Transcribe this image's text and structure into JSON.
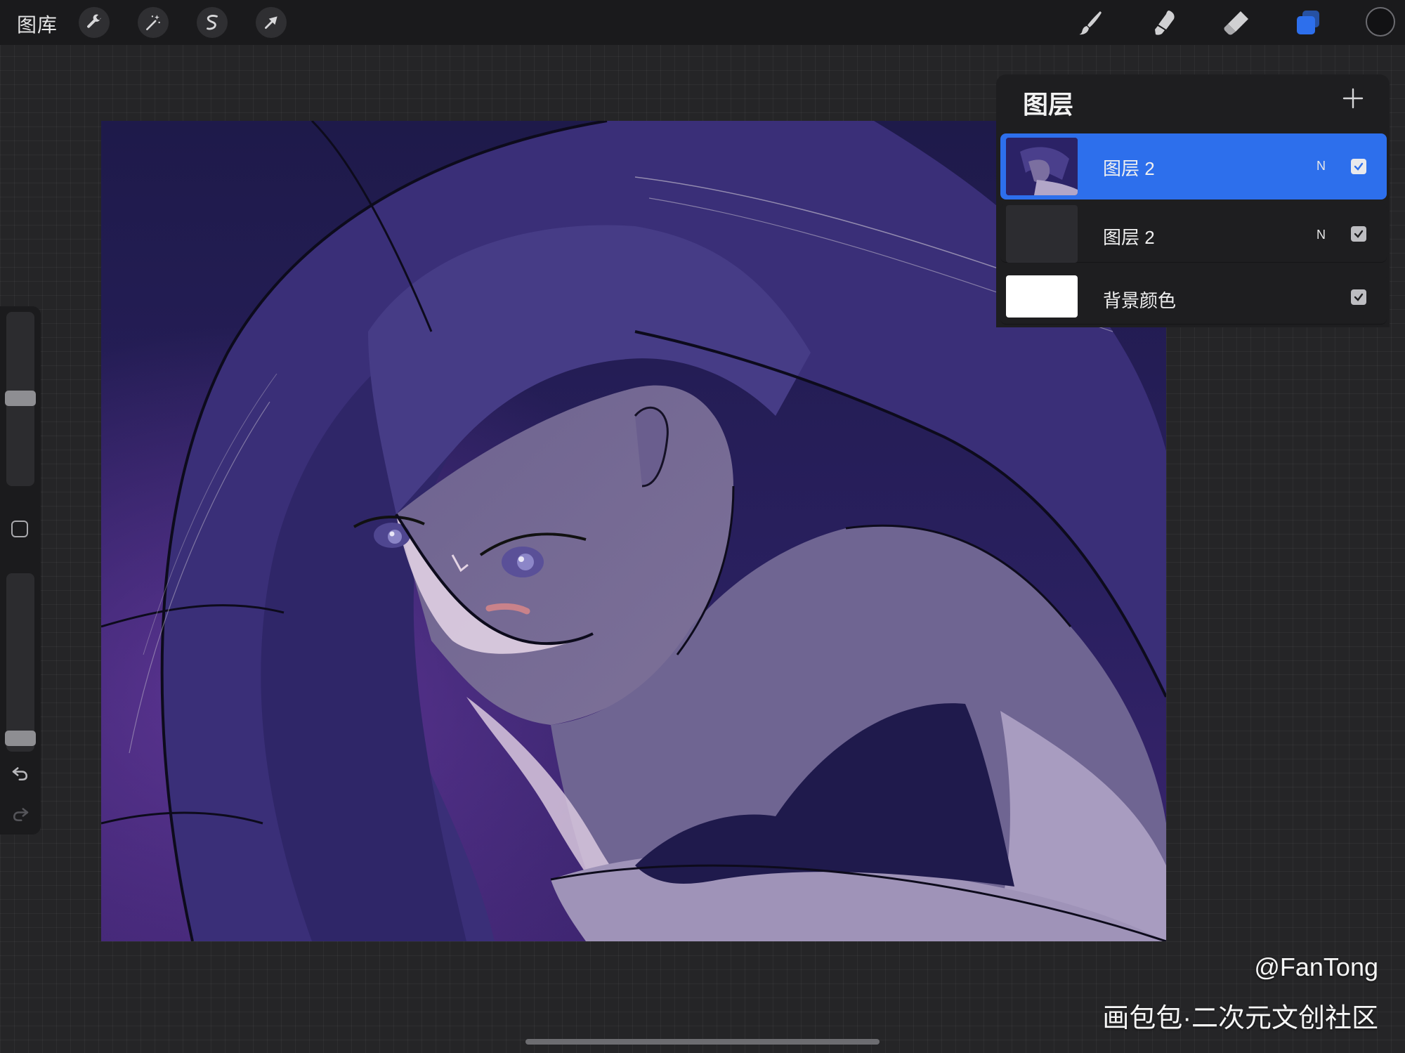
{
  "toolbar": {
    "gallery_label": "图库",
    "left_tools": [
      "wrench-icon",
      "magic-wand-icon",
      "selection-icon",
      "transform-arrow-icon"
    ],
    "right_tools": [
      "brush-icon",
      "smudge-icon",
      "eraser-icon",
      "layers-icon"
    ],
    "active_color": "#121214",
    "accent_color": "#2d6fec"
  },
  "sidebar": {
    "brush_size_level": 0.5,
    "opacity_level": 0.97,
    "undo_icon": "undo-icon",
    "redo_icon": "redo-icon"
  },
  "layers_panel": {
    "title": "图层",
    "add_icon": "plus-icon",
    "layers": [
      {
        "name": "图层 2",
        "blend": "N",
        "visible": true,
        "active": true
      },
      {
        "name": "图层 2",
        "blend": "N",
        "visible": true,
        "active": false
      },
      {
        "name": "背景颜色",
        "blend": "",
        "visible": true,
        "active": false
      }
    ]
  },
  "watermark": {
    "handle": "@FanTong",
    "site": "画包包·二次元文创社区"
  }
}
